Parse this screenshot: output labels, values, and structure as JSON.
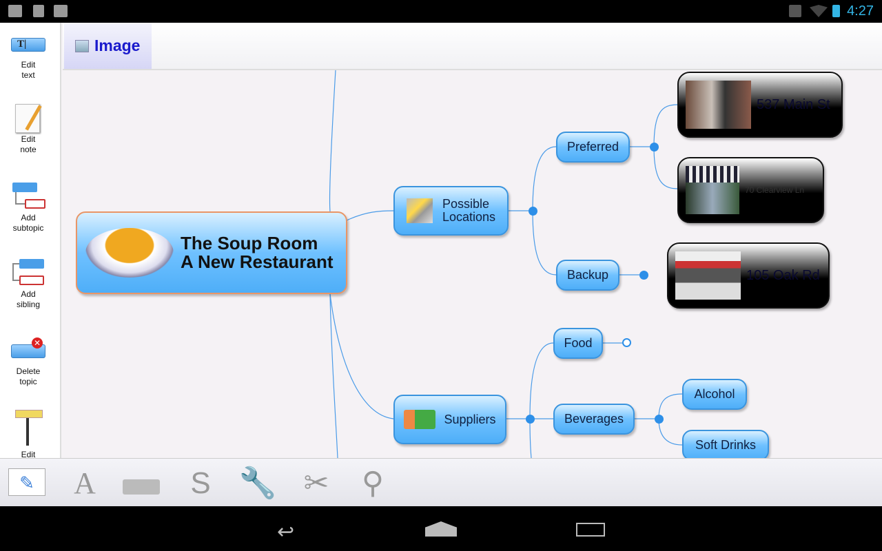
{
  "status_bar": {
    "time": "4:27",
    "icons": [
      "gallery-icon",
      "download-icon",
      "store-download-icon",
      "mute-icon",
      "wifi-icon",
      "battery-icon"
    ]
  },
  "sidebar": {
    "items": [
      {
        "label": "Edit text",
        "icon": "edit-text-icon"
      },
      {
        "label": "Edit note",
        "icon": "notepad-icon"
      },
      {
        "label": "Add subtopic",
        "icon": "add-subtopic-icon"
      },
      {
        "label": "Add sibling",
        "icon": "add-sibling-icon"
      },
      {
        "label": "Delete topic",
        "icon": "delete-topic-icon"
      },
      {
        "label": "Edit",
        "icon": "paint-roller-icon"
      }
    ]
  },
  "tab": {
    "label": "Image",
    "icon": "image-icon"
  },
  "mindmap": {
    "central": {
      "line1": "The Soup Room",
      "line2": "A New Restaurant"
    },
    "locations": {
      "line1": "Possible",
      "line2": "Locations"
    },
    "preferred": "Preferred",
    "backup": "Backup",
    "addresses": [
      "537 Main St",
      "70 Clearview Ln",
      "105 Oak Rd"
    ],
    "suppliers": "Suppliers",
    "food": "Food",
    "beverages": "Beverages",
    "alcohol": "Alcohol",
    "soft_drinks": "Soft Drinks"
  },
  "bottom_toolbar": {
    "tools": [
      "mindmap-edit-icon",
      "font-icon",
      "eraser-icon",
      "strikethrough-s-icon",
      "wrench-icon",
      "scissors-icon",
      "magnifier-icon"
    ]
  },
  "colors": {
    "node": "#6fc1ff",
    "connector": "#2d8fe8",
    "tab_text": "#1a1acc",
    "clock": "#33b5e5"
  }
}
